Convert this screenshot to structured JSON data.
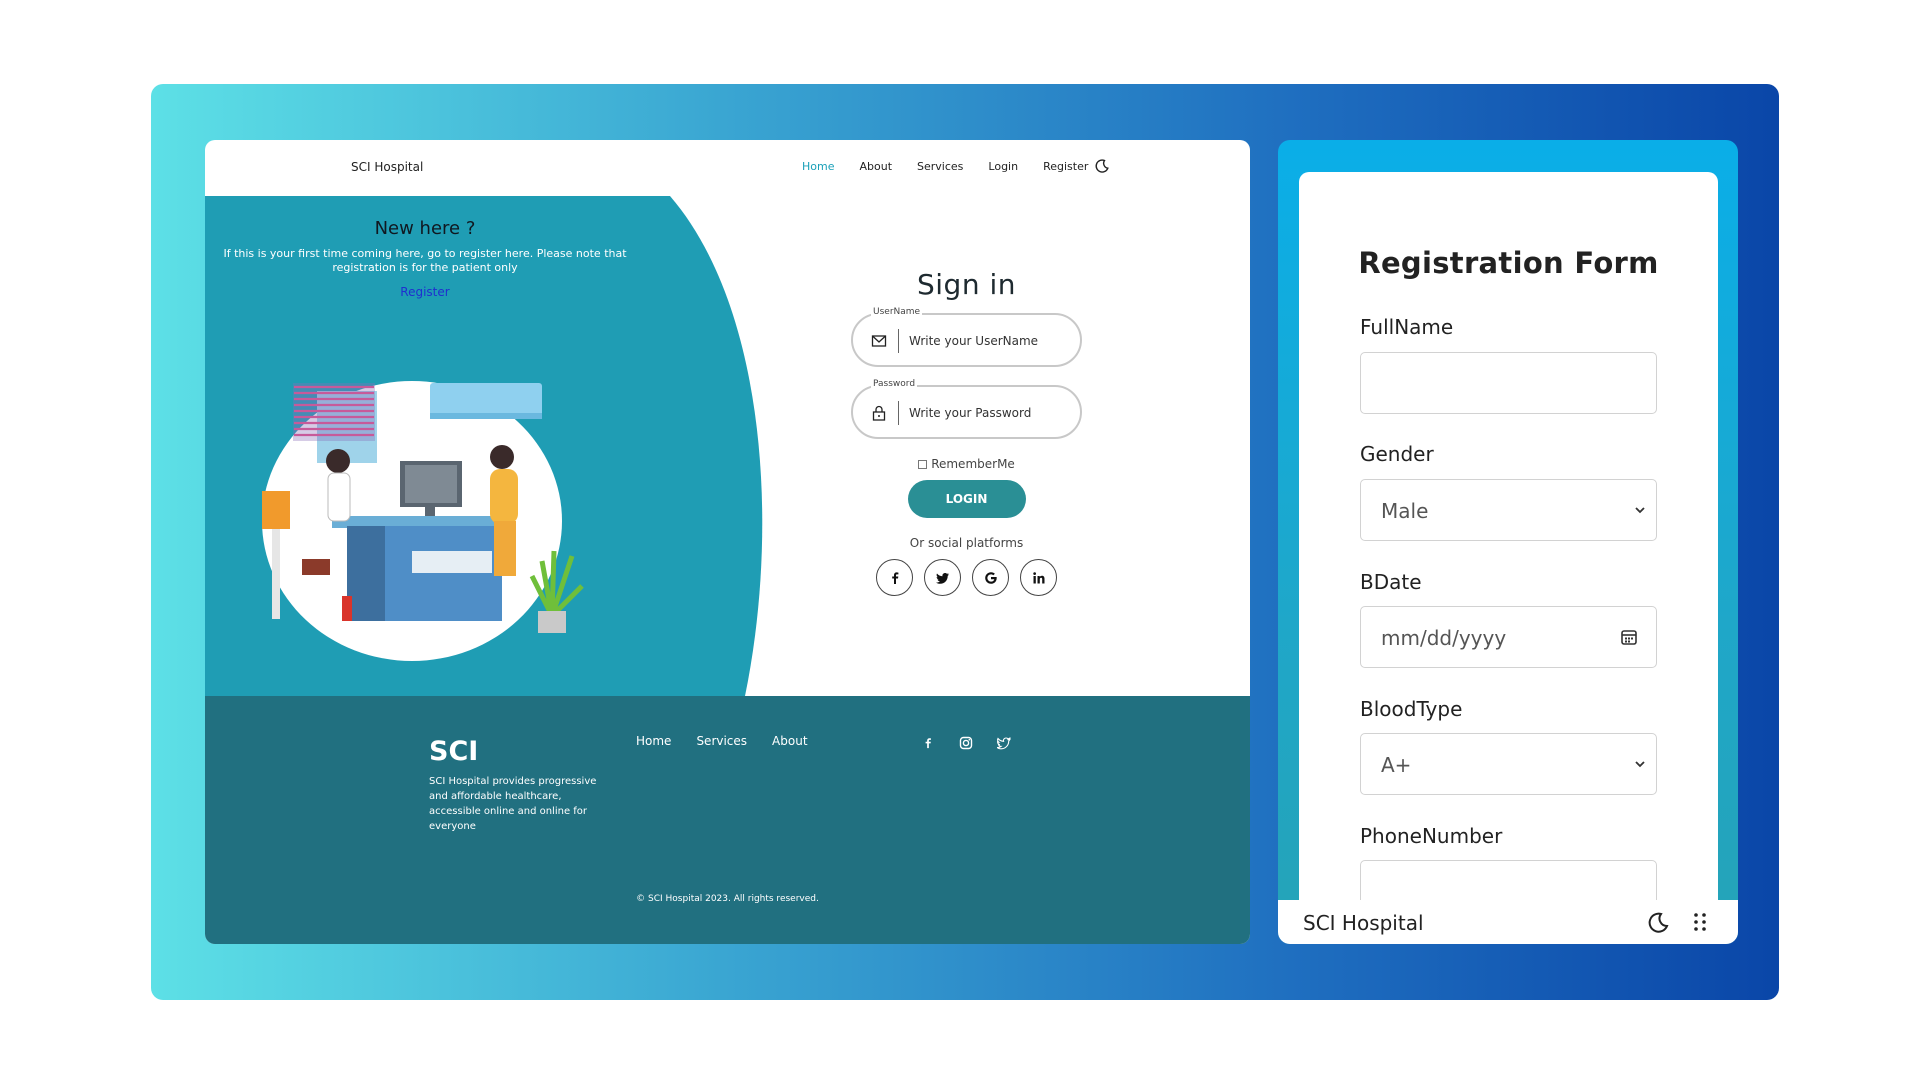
{
  "desktop": {
    "brand": "SCI Hospital",
    "nav": [
      "Home",
      "About",
      "Services",
      "Login",
      "Register"
    ],
    "hero": {
      "title": "New here ?",
      "text": "If this is your first time coming here, go to register here. Please note that registration is for the patient only",
      "link": "Register"
    },
    "signin": {
      "title": "Sign in",
      "username_label": "UserName",
      "username_placeholder": "Write your UserName",
      "password_label": "Password",
      "password_placeholder": "Write your Password",
      "remember": "RememberMe",
      "login_button": "LOGIN",
      "social_text": "Or social platforms",
      "socials": [
        "facebook-icon",
        "twitter-icon",
        "google-icon",
        "linkedin-icon"
      ]
    },
    "footer": {
      "logo": "SCI",
      "description": "SCI Hospital provides progressive and affordable healthcare, accessible online and online for everyone",
      "links": [
        "Home",
        "Services",
        "About"
      ],
      "icons": [
        "facebook-icon",
        "instagram-icon",
        "twitter-icon"
      ],
      "copyright": "© SCI Hospital 2023. All rights reserved."
    },
    "colors": {
      "accent": "#1aa0b8",
      "button": "#2a8f95",
      "footer": "#217080",
      "link": "#1f2fd0"
    }
  },
  "mobile": {
    "form_title": "Registration Form",
    "fields": {
      "fullname_label": "FullName",
      "fullname_value": "",
      "gender_label": "Gender",
      "gender_value": "Male",
      "bdate_label": "BDate",
      "bdate_placeholder": "mm/dd/yyyy",
      "bloodtype_label": "BloodType",
      "bloodtype_value": "A+",
      "phone_label": "PhoneNumber",
      "phone_value": ""
    },
    "bottom_bar_title": "SCI Hospital"
  }
}
